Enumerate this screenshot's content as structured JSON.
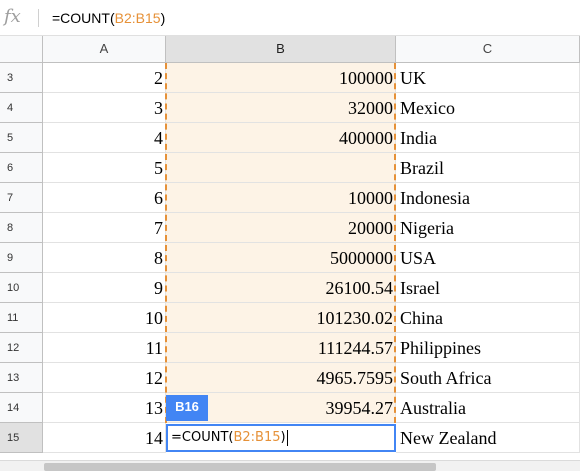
{
  "formula_bar": {
    "fx_label": "fx",
    "prefix": "=COUNT(",
    "range_ref": "B2:B15",
    "suffix": ")"
  },
  "columns": [
    "A",
    "B",
    "C"
  ],
  "selected_column": "B",
  "rows": [
    {
      "row": "3",
      "a": "2",
      "b": "100000",
      "c": "UK"
    },
    {
      "row": "4",
      "a": "3",
      "b": "32000",
      "c": "Mexico"
    },
    {
      "row": "5",
      "a": "4",
      "b": "400000",
      "c": "India"
    },
    {
      "row": "6",
      "a": "5",
      "b": "",
      "c": "Brazil"
    },
    {
      "row": "7",
      "a": "6",
      "b": "10000",
      "c": "Indonesia"
    },
    {
      "row": "8",
      "a": "7",
      "b": "20000",
      "c": "Nigeria"
    },
    {
      "row": "9",
      "a": "8",
      "b": "5000000",
      "c": "USA"
    },
    {
      "row": "10",
      "a": "9",
      "b": "26100.54",
      "c": "Israel"
    },
    {
      "row": "11",
      "a": "10",
      "b": "101230.02",
      "c": "China"
    },
    {
      "row": "12",
      "a": "11",
      "b": "111244.57",
      "c": "Philippines"
    },
    {
      "row": "13",
      "a": "12",
      "b": "4965.7595",
      "c": "South Africa"
    },
    {
      "row": "14",
      "a": "13",
      "b": "39954.27",
      "c": "Australia"
    },
    {
      "row": "15",
      "a": "14",
      "b": "",
      "c": "New Zealand"
    }
  ],
  "editing_cell": {
    "tag": "B16",
    "prefix": "=COUNT(",
    "range_ref": "B2:B15",
    "suffix": ")"
  },
  "colors": {
    "range_highlight": "#e69138",
    "selection_blue": "#4285f4",
    "range_fill": "#fdf3e6"
  }
}
